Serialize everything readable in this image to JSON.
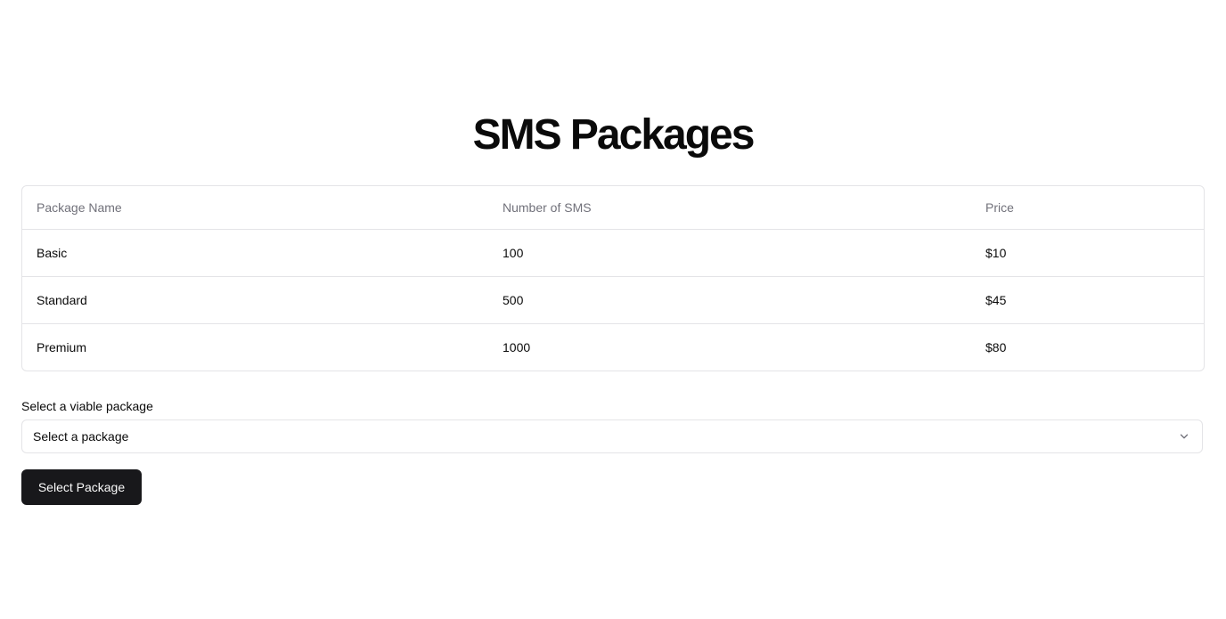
{
  "page": {
    "title": "SMS Packages"
  },
  "table": {
    "headers": [
      "Package Name",
      "Number of SMS",
      "Price"
    ],
    "rows": [
      [
        "Basic",
        "100",
        "$10"
      ],
      [
        "Standard",
        "500",
        "$45"
      ],
      [
        "Premium",
        "1000",
        "$80"
      ]
    ]
  },
  "form": {
    "select_label": "Select a viable package",
    "select_value": "Select a package",
    "select_icon": "chevron-down-icon",
    "button_label": "Select Package"
  },
  "colors": {
    "button_bg": "#18181b",
    "border": "#e4e4e7",
    "header_text": "#71717a"
  }
}
